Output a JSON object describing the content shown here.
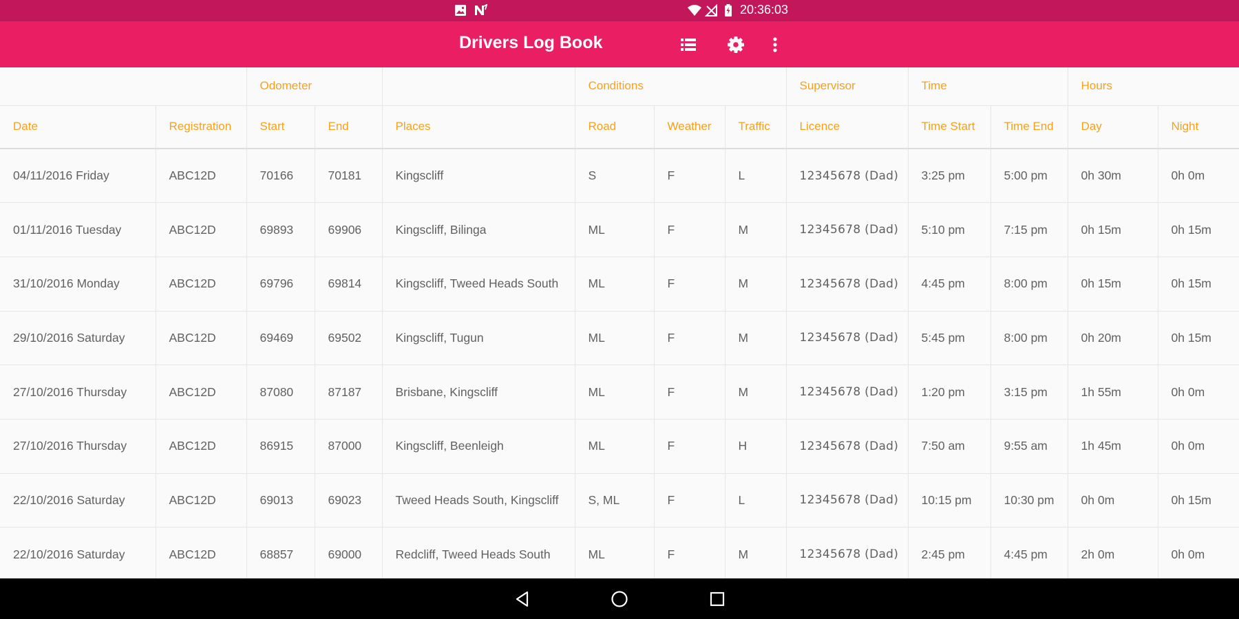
{
  "status_bar": {
    "time": "20:36:03",
    "icons": [
      "image-notification-icon",
      "n-notification-icon",
      "wifi-icon",
      "no-signal-icon",
      "battery-charging-icon"
    ]
  },
  "app_bar": {
    "title": "Drivers Log Book",
    "actions": [
      "list-view-icon",
      "settings-gear-icon",
      "overflow-menu-icon"
    ]
  },
  "colors": {
    "status_bar": "#c2185b",
    "app_bar": "#e91e63",
    "header_text": "#f7a11a",
    "cell_text": "#616161",
    "nav_bar": "#000000"
  },
  "table": {
    "group_headers": [
      {
        "label": "",
        "span": 2
      },
      {
        "label": "Odometer",
        "span": 2
      },
      {
        "label": "",
        "span": 1
      },
      {
        "label": "Conditions",
        "span": 3
      },
      {
        "label": "Supervisor",
        "span": 1
      },
      {
        "label": "Time",
        "span": 2
      },
      {
        "label": "Hours",
        "span": 2
      }
    ],
    "columns": [
      "Date",
      "Registration",
      "Start",
      "End",
      "Places",
      "Road",
      "Weather",
      "Traffic",
      "Licence",
      "Time Start",
      "Time End",
      "Day",
      "Night"
    ],
    "rows": [
      [
        "04/11/2016 Friday",
        "ABC12D",
        "70166",
        "70181",
        "Kingscliff",
        "S",
        "F",
        "L",
        "12345678 (Dad)",
        "3:25 pm",
        "5:00 pm",
        "0h 30m",
        "0h 0m"
      ],
      [
        "01/11/2016 Tuesday",
        "ABC12D",
        "69893",
        "69906",
        "Kingscliff, Bilinga",
        "ML",
        "F",
        "M",
        "12345678 (Dad)",
        "5:10 pm",
        "7:15 pm",
        "0h 15m",
        "0h 15m"
      ],
      [
        "31/10/2016 Monday",
        "ABC12D",
        "69796",
        "69814",
        "Kingscliff, Tweed Heads South",
        "ML",
        "F",
        "M",
        "12345678 (Dad)",
        "4:45 pm",
        "8:00 pm",
        "0h 15m",
        "0h 15m"
      ],
      [
        "29/10/2016 Saturday",
        "ABC12D",
        "69469",
        "69502",
        "Kingscliff, Tugun",
        "ML",
        "F",
        "M",
        "12345678 (Dad)",
        "5:45 pm",
        "8:00 pm",
        "0h 20m",
        "0h 15m"
      ],
      [
        "27/10/2016 Thursday",
        "ABC12D",
        "87080",
        "87187",
        "Brisbane, Kingscliff",
        "ML",
        "F",
        "M",
        "12345678 (Dad)",
        "1:20 pm",
        "3:15 pm",
        "1h 55m",
        "0h 0m"
      ],
      [
        "27/10/2016 Thursday",
        "ABC12D",
        "86915",
        "87000",
        "Kingscliff, Beenleigh",
        "ML",
        "F",
        "H",
        "12345678 (Dad)",
        "7:50 am",
        "9:55 am",
        "1h 45m",
        "0h 0m"
      ],
      [
        "22/10/2016 Saturday",
        "ABC12D",
        "69013",
        "69023",
        "Tweed Heads South, Kingscliff",
        "S, ML",
        "F",
        "L",
        "12345678 (Dad)",
        "10:15 pm",
        "10:30 pm",
        "0h 0m",
        "0h 15m"
      ],
      [
        "22/10/2016 Saturday",
        "ABC12D",
        "68857",
        "69000",
        "Redcliff, Tweed Heads South",
        "ML",
        "F",
        "M",
        "12345678 (Dad)",
        "2:45 pm",
        "4:45 pm",
        "2h 0m",
        "0h 0m"
      ]
    ]
  },
  "nav_bar": {
    "buttons": [
      "back-icon",
      "home-icon",
      "recents-icon"
    ]
  }
}
